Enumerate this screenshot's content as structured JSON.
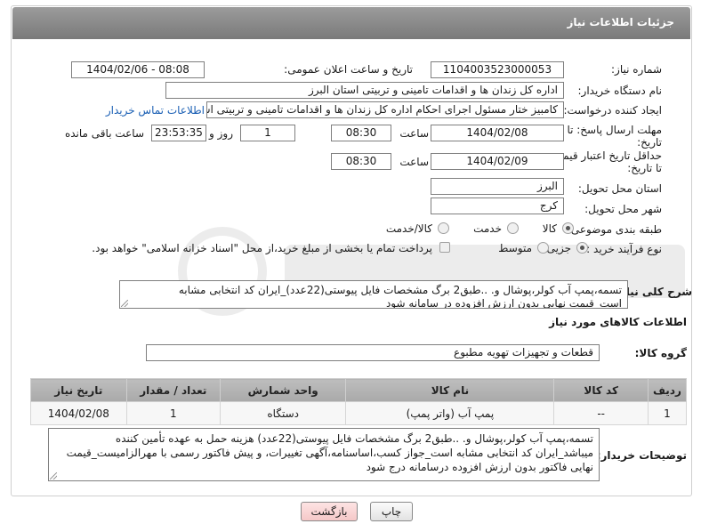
{
  "header": {
    "title": "جزئیات اطلاعات نیاز"
  },
  "fields": {
    "need_number_label": "شماره نیاز:",
    "need_number": "1104003523000053",
    "announce_label": "تاریخ و ساعت اعلان عمومی:",
    "announce_value": "1404/02/06 - 08:08",
    "buyer_org_label": "نام دستگاه خریدار:",
    "buyer_org": "اداره کل زندان ها و اقدامات تامینی و تربیتی استان البرز",
    "creator_label": "ایجاد کننده درخواست:",
    "creator": "کامبیز ختار مسئول اجرای احکام اداره کل زندان ها و اقدامات تامینی و تربیتی اس",
    "contact_link": "اطلاعات تماس خریدار",
    "deadline_label_1": "مهلت ارسال پاسخ: تا",
    "deadline_label_2": "تاریخ:",
    "deadline_date": "1404/02/08",
    "time_label": "ساعت",
    "deadline_time": "08:30",
    "days_value": "1",
    "days_label": "روز و",
    "remaining_value": "23:53:35",
    "remaining_label": "ساعت باقی مانده",
    "validity_label_1": "حداقل تاریخ اعتبار قیمت:",
    "validity_label_2": "تا تاریخ:",
    "validity_date": "1404/02/09",
    "validity_time": "08:30",
    "province_label": "استان محل تحویل:",
    "province": "البرز",
    "city_label": "شهر محل تحویل:",
    "city": "کرج",
    "category_label": "طبقه بندی موضوعی:",
    "category_options": [
      "کالا",
      "خدمت",
      "کالا/خدمت"
    ],
    "process_label": "نوع فرآیند خرید :",
    "process_options": [
      "جزیی",
      "متوسط"
    ],
    "payment_note": "پرداخت تمام یا بخشی از مبلغ خرید،از محل \"اسناد خزانه اسلامی\" خواهد بود."
  },
  "summary": {
    "label": "شرح کلی نیاز:",
    "text": "تسمه،پمپ آب کولر،پوشال  و. ..طبق2 برگ مشخصات فایل پیوستی(22عدد)_ایران کد انتخابی مشابه است_قیمت نهایی بدون ارزش افزوده در سامانه  شود"
  },
  "goods": {
    "section_title": "اطلاعات کالاهای مورد نیاز",
    "group_label": "گروه کالا:",
    "group_value": "قطعات و تجهیزات تهویه مطبوع",
    "columns": [
      "ردیف",
      "کد کالا",
      "نام کالا",
      "واحد شمارش",
      "تعداد / مقدار",
      "تاریخ نیاز"
    ],
    "rows": [
      [
        "1",
        "--",
        "پمپ آب (واتر پمپ)",
        "دستگاه",
        "1",
        "1404/02/08"
      ]
    ]
  },
  "buyer_notes": {
    "label": "توضیحات خریدار:",
    "text": "تسمه،پمپ آب کولر،پوشال  و. ..طبق2 برگ مشخصات فایل پیوستی(22عدد) هزینه حمل به عهده تأمین کننده میباشد_ایران کد انتخابی مشابه است_جواز کسب،اساسنامه،آگهی تغییرات، و پیش فاکتور رسمی با مهرالزامیست_قیمت نهایی فاکتور بدون ارزش افزوده درسامانه درج شود"
  },
  "buttons": {
    "print": "چاپ",
    "back": "بازگشت"
  },
  "colors": {
    "header_bg": "#8a8a8a",
    "link": "#1a5fb4",
    "back_btn": "#f5c8c8"
  }
}
